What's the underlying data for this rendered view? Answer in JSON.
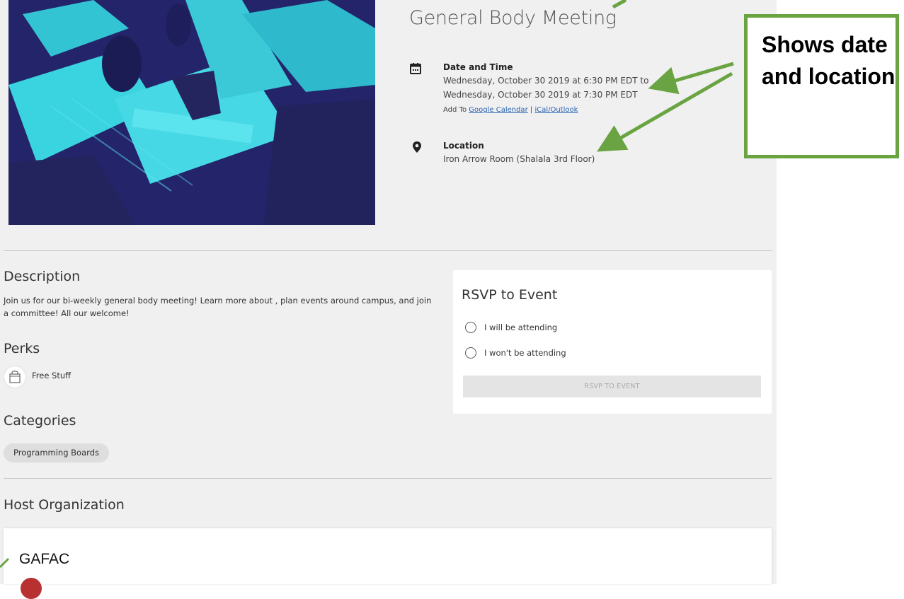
{
  "event": {
    "title": "General Body Meeting",
    "date_time": {
      "heading": "Date and Time",
      "line1": "Wednesday, October 30 2019 at 6:30 PM EDT to",
      "line2": "Wednesday, October 30 2019 at 7:30 PM EDT",
      "add_to_label": "Add To",
      "google_link": "Google Calendar",
      "separator": "|",
      "ical_link": "iCal/Outlook"
    },
    "location": {
      "heading": "Location",
      "value": "Iron Arrow Room (Shalala 3rd Floor)"
    }
  },
  "description": {
    "heading": "Description",
    "text": "Join us for our bi-weekly general body meeting! Learn more about       , plan events around campus, and join a committee! All our welcome!"
  },
  "perks": {
    "heading": "Perks",
    "items": [
      {
        "label": "Free Stuff",
        "icon": "shopping-bag-icon"
      }
    ]
  },
  "categories": {
    "heading": "Categories",
    "items": [
      "Programming Boards"
    ]
  },
  "rsvp": {
    "title": "RSVP to Event",
    "options": [
      "I will be attending",
      "I won't be attending"
    ],
    "button_label": "RSVP TO EVENT"
  },
  "host": {
    "heading": "Host Organization",
    "name": "GAFAC"
  },
  "annotation": {
    "text": "Shows date and location",
    "color": "#6aa442"
  },
  "icons": {
    "date": "calendar-icon",
    "location": "map-pin-icon"
  }
}
